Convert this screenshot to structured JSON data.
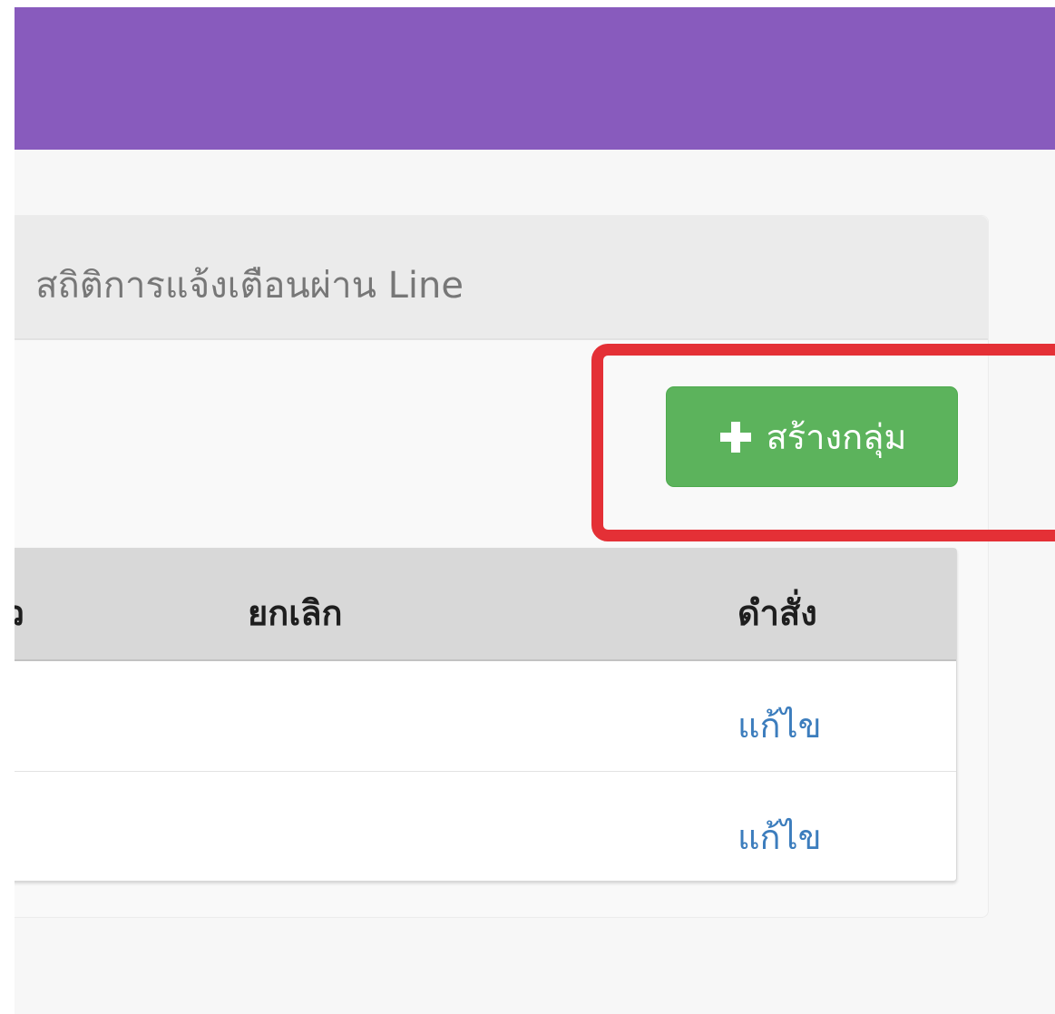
{
  "panel": {
    "title": "สถิติการแจ้งเตือนผ่าน Line"
  },
  "toolbar": {
    "create_group_label": "สร้างกลุ่ม"
  },
  "table": {
    "columns": [
      "ยกเลิก",
      "ดำสั่ง"
    ],
    "rows": [
      {
        "command": "แก้ไข"
      },
      {
        "command": "แก้ไข"
      }
    ]
  },
  "colors": {
    "header_bar": "#885bbd",
    "create_button": "#5cb35c",
    "highlight": "#e43036",
    "link": "#3c7dbd"
  }
}
